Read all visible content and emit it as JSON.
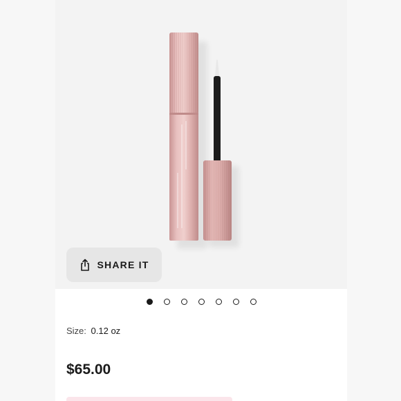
{
  "gallery": {
    "image_name": "lash-serum-product-photo",
    "active_index": 0,
    "dot_count": 7
  },
  "share": {
    "label": "SHARE IT",
    "icon": "share-icon"
  },
  "product": {
    "size_label": "Size:",
    "size_value": "0.12 oz",
    "price": "$65.00"
  },
  "colors": {
    "tube_pink": "#d9a9a9",
    "tube_highlight": "#f2d4d2",
    "tube_shadow": "#b88383",
    "applicator": "#1b1b1b",
    "active_dot": "#1a1a1a",
    "add_button_pink": "#fbe5ea"
  }
}
